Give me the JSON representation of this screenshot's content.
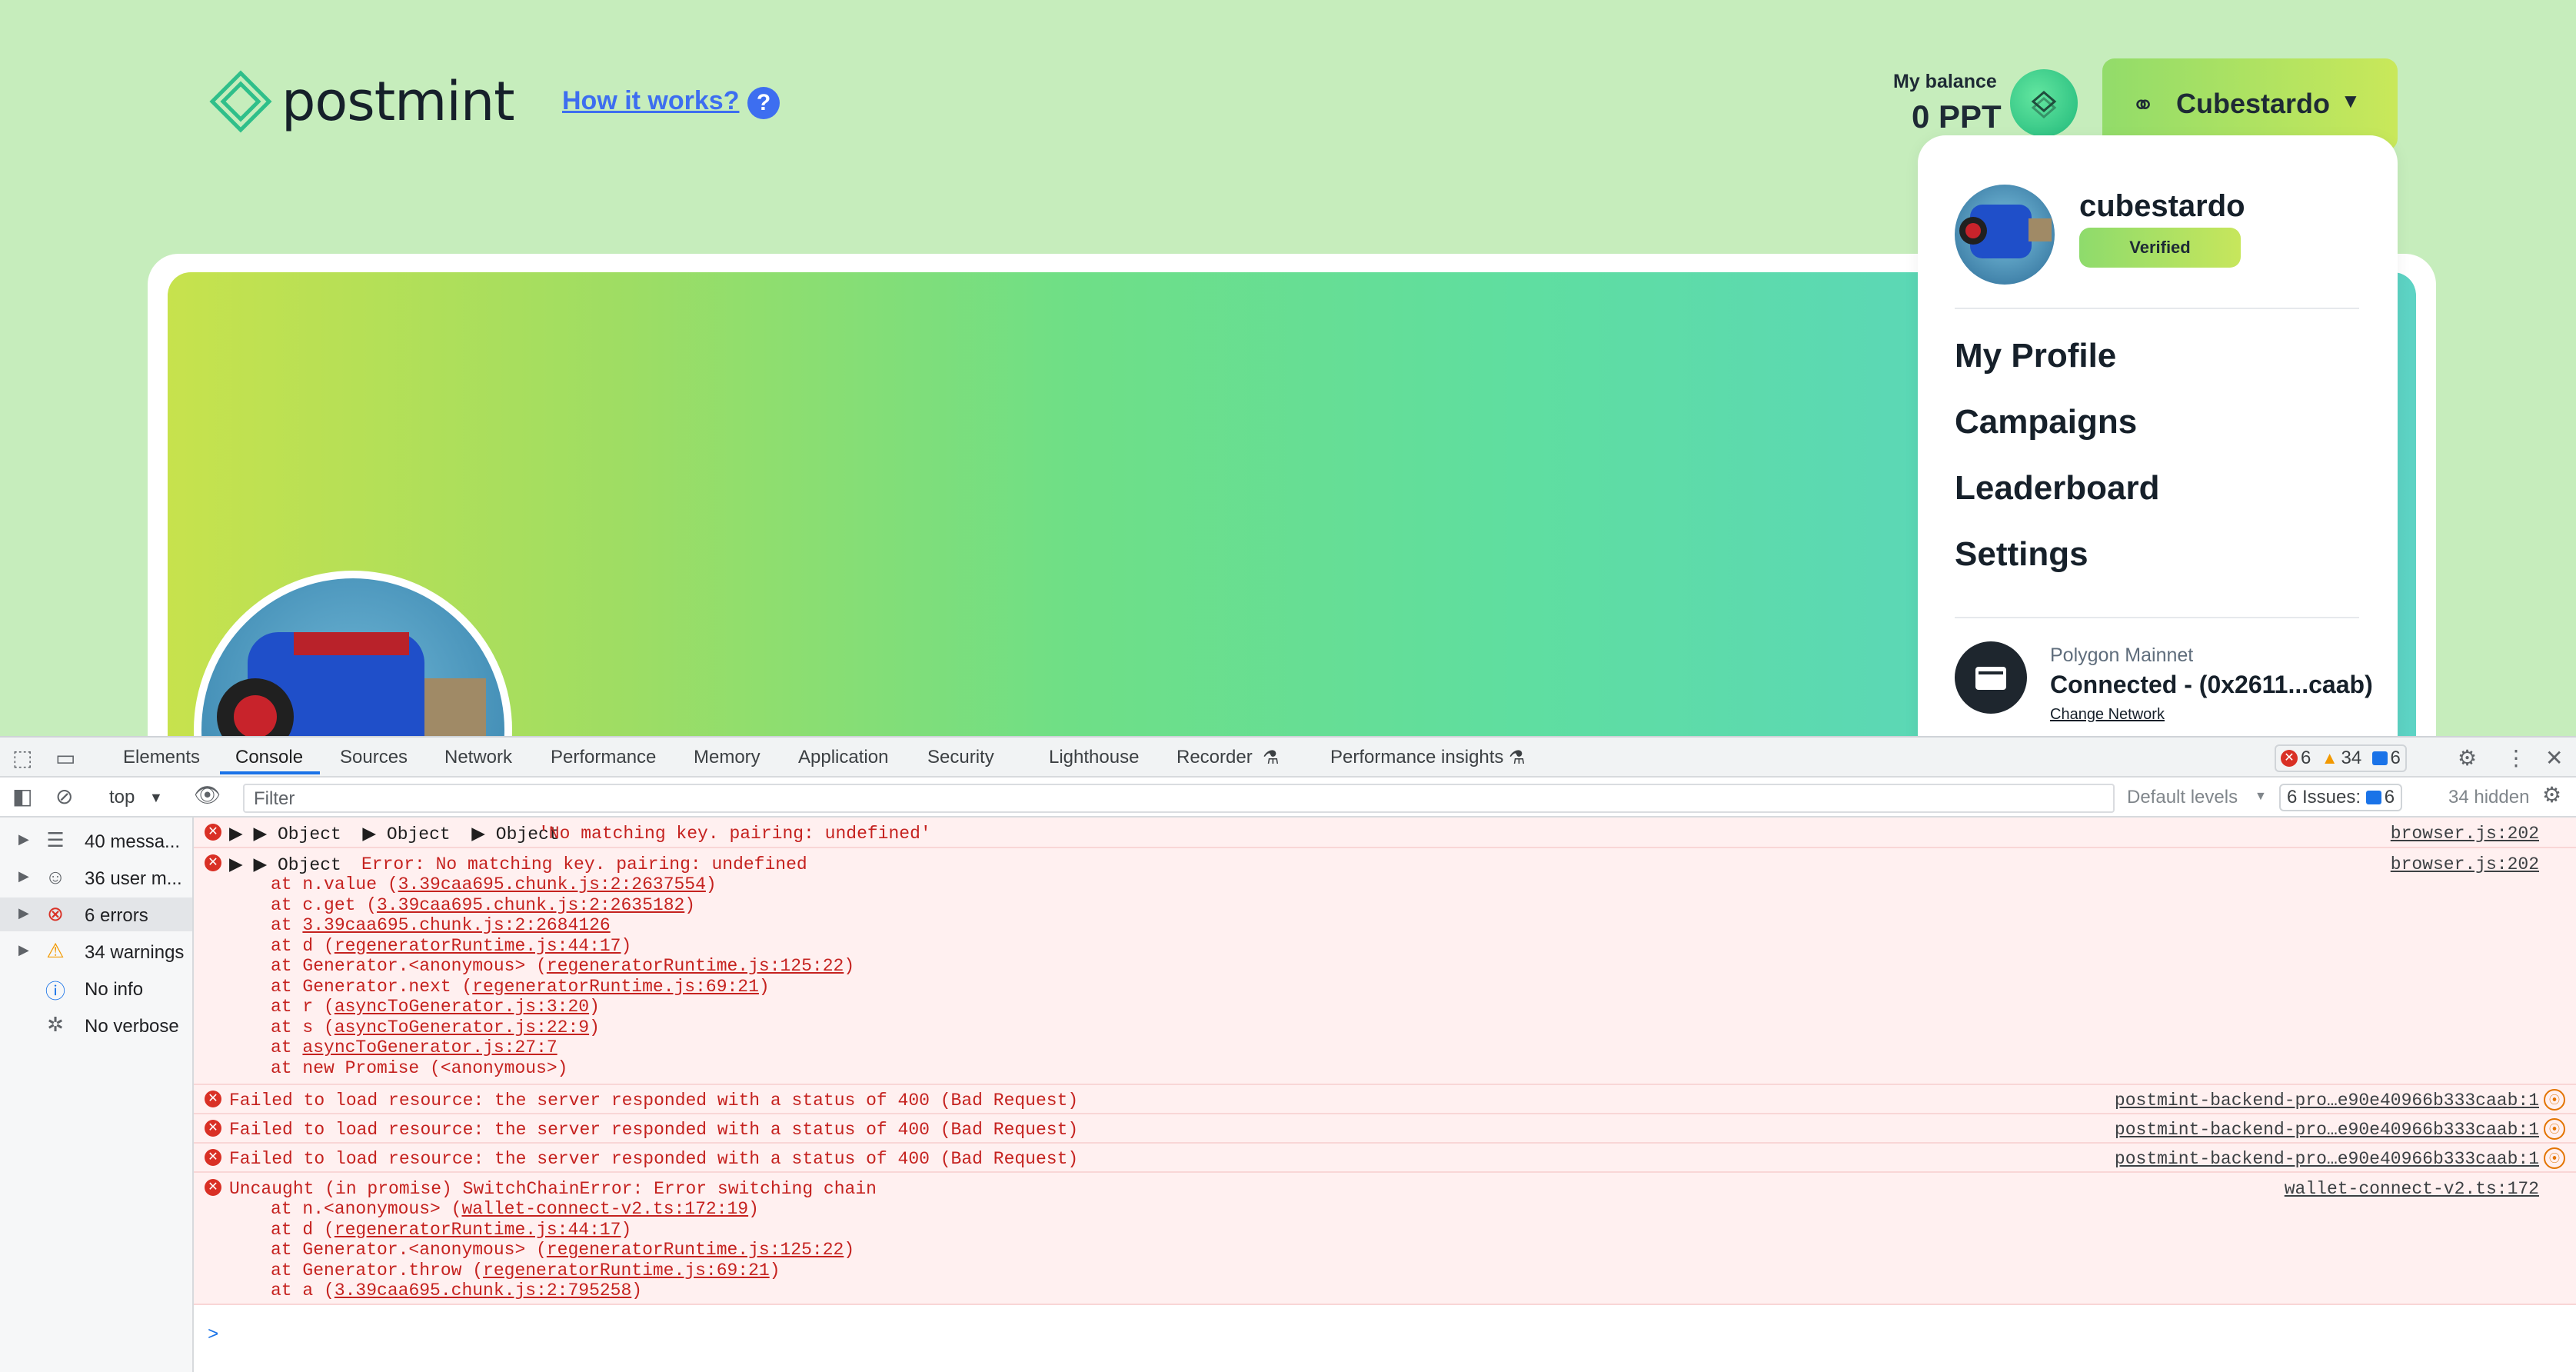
{
  "header": {
    "logo_text": "postmint",
    "how_link": "How it works?",
    "help_icon": "?",
    "balance_label": "My balance",
    "balance_value": "0 PPT",
    "token_icon": "polygon-token-icon",
    "user_button": "Cubestardo"
  },
  "dropdown": {
    "username": "cubestardo",
    "badge": "Verified",
    "items": [
      "My Profile",
      "Campaigns",
      "Leaderboard",
      "Settings"
    ],
    "network_label": "Polygon Mainnet",
    "connected": "Connected - (0x2611...caab)",
    "change_network": "Change Network"
  },
  "devtools": {
    "tabs": [
      "Elements",
      "Console",
      "Sources",
      "Network",
      "Performance",
      "Memory",
      "Application",
      "Security",
      "Lighthouse",
      "Recorder",
      "Performance insights"
    ],
    "active_tab": "Console",
    "error_count": "6",
    "warning_count": "34",
    "info_count": "6",
    "context": "top",
    "filter_placeholder": "Filter",
    "default_levels": "Default levels",
    "issues_label": "6 Issues:",
    "issues_count": "6",
    "hidden": "34 hidden",
    "sidebar": [
      {
        "label": "40 messa...",
        "icon": "list-icon"
      },
      {
        "label": "36 user m...",
        "icon": "user-icon"
      },
      {
        "label": "6 errors",
        "icon": "error-icon"
      },
      {
        "label": "34 warnings",
        "icon": "warning-icon"
      },
      {
        "label": "No info",
        "icon": "info-icon"
      },
      {
        "label": "No verbose",
        "icon": "bug-icon"
      }
    ],
    "logs": {
      "r1_msg": "▶ ▶ Object  ▶ Object  ▶ Object ",
      "r1_str": "'No matching key. pairing: undefined'",
      "r1_src": "browser.js:202",
      "r2_head": "▶ ▶ Object ",
      "r2_err": "Error: No matching key. pairing: undefined",
      "r2_src": "browser.js:202",
      "r2_stack": [
        [
          "at n.value (",
          "3.39caa695.chunk.js:2:2637554",
          ")"
        ],
        [
          "at c.get (",
          "3.39caa695.chunk.js:2:2635182",
          ")"
        ],
        [
          "at ",
          "3.39caa695.chunk.js:2:2684126",
          ""
        ],
        [
          "at d (",
          "regeneratorRuntime.js:44:17",
          ")"
        ],
        [
          "at Generator.<anonymous> (",
          "regeneratorRuntime.js:125:22",
          ")"
        ],
        [
          "at Generator.next (",
          "regeneratorRuntime.js:69:21",
          ")"
        ],
        [
          "at r (",
          "asyncToGenerator.js:3:20",
          ")"
        ],
        [
          "at s (",
          "asyncToGenerator.js:22:9",
          ")"
        ],
        [
          "at ",
          "asyncToGenerator.js:27:7",
          ""
        ],
        [
          "at new Promise (<anonymous>)",
          "",
          ""
        ]
      ],
      "r3_msg": "Failed to load resource: the server responded with a status of 400 (Bad Request)",
      "r3_src": "postmint-backend-pro…e90e40966b333caab:1",
      "r6_msg": "Uncaught (in promise) SwitchChainError: Error switching chain",
      "r6_src": "wallet-connect-v2.ts:172",
      "r6_stack": [
        [
          "at n.<anonymous> (",
          "wallet-connect-v2.ts:172:19",
          ")"
        ],
        [
          "at d (",
          "regeneratorRuntime.js:44:17",
          ")"
        ],
        [
          "at Generator.<anonymous> (",
          "regeneratorRuntime.js:125:22",
          ")"
        ],
        [
          "at Generator.throw (",
          "regeneratorRuntime.js:69:21",
          ")"
        ],
        [
          "at a (",
          "3.39caa695.chunk.js:2:795258",
          ")"
        ]
      ]
    },
    "prompt": ">"
  }
}
